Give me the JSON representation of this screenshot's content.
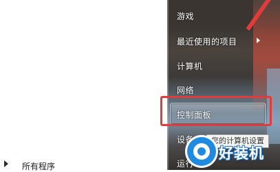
{
  "left_pane": {
    "all_programs": "所有程序"
  },
  "menu": {
    "items": [
      {
        "label": "游戏"
      },
      {
        "label": "最近使用的项目"
      },
      {
        "label": "计算机"
      },
      {
        "label": "网络"
      },
      {
        "label": "控制面板"
      },
      {
        "label": "设备"
      },
      {
        "label": "运行"
      }
    ]
  },
  "tooltip": "您的计算机设置",
  "watermark": {
    "text": "好装机"
  },
  "colors": {
    "annotation": "#e23b3b",
    "watermark_blue": "#1e8be0"
  }
}
